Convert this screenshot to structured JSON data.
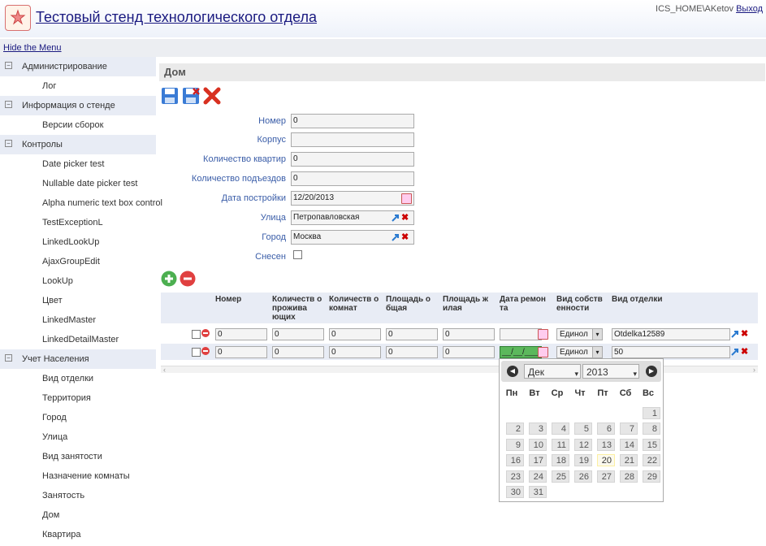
{
  "header": {
    "title": "Тестовый стенд технологического отдела",
    "user": "ICS_HOME\\AKetov",
    "logout": "Выход"
  },
  "menu": {
    "hide_label": "Hide the Menu"
  },
  "sidebar": {
    "sections": [
      {
        "label": "Администрирование",
        "items": [
          "Лог"
        ]
      },
      {
        "label": "Информация о стенде",
        "items": [
          "Версии сборок"
        ]
      },
      {
        "label": "Контролы",
        "items": [
          "Date picker test",
          "Nullable date picker test",
          "Alpha numeric text box control",
          "TestExceptionL",
          "LinkedLookUp",
          "AjaxGroupEdit",
          "LookUp",
          "Цвет",
          "LinkedMaster",
          "LinkedDetailMaster"
        ]
      },
      {
        "label": "Учет Населения",
        "items": [
          "Вид отделки",
          "Территория",
          "Город",
          "Улица",
          "Вид занятости",
          "Назначение комнаты",
          "Занятость",
          "Дом",
          "Квартира"
        ]
      }
    ]
  },
  "page": {
    "title": "Дом"
  },
  "form": {
    "nomer": {
      "label": "Номер",
      "value": "0"
    },
    "korpus": {
      "label": "Корпус",
      "value": ""
    },
    "kvartir": {
      "label": "Количество квартир",
      "value": "0"
    },
    "podezdov": {
      "label": "Количество подъездов",
      "value": "0"
    },
    "data": {
      "label": "Дата постройки",
      "value": "12/20/2013"
    },
    "ulica": {
      "label": "Улица",
      "value": "Петропавловская"
    },
    "gorod": {
      "label": "Город",
      "value": "Москва"
    },
    "snesen": {
      "label": "Снесен",
      "checked": false
    }
  },
  "grid": {
    "headers": [
      "Номер",
      "Количеств о прожива ющих",
      "Количеств о комнат",
      "Площадь о бщая",
      "Площадь ж илая",
      "Дата ремон та",
      "Вид собств енности",
      "Вид отделки"
    ],
    "rows": [
      {
        "nomer": "0",
        "projiv": "0",
        "komnat": "0",
        "obsh": "0",
        "jil": "0",
        "date": "",
        "sobst": "Единол",
        "otdelka": "Otdelka12589"
      },
      {
        "nomer": "0",
        "projiv": "0",
        "komnat": "0",
        "obsh": "0",
        "jil": "0",
        "date": "__/__/____",
        "sobst": "Единол",
        "otdelka": "50"
      }
    ]
  },
  "calendar": {
    "month": "Дек",
    "year": "2013",
    "weekdays": [
      "Пн",
      "Вт",
      "Ср",
      "Чт",
      "Пт",
      "Сб",
      "Вс"
    ],
    "weeks": [
      [
        "",
        "",
        "",
        "",
        "",
        "",
        "1"
      ],
      [
        "2",
        "3",
        "4",
        "5",
        "6",
        "7",
        "8"
      ],
      [
        "9",
        "10",
        "11",
        "12",
        "13",
        "14",
        "15"
      ],
      [
        "16",
        "17",
        "18",
        "19",
        "20",
        "21",
        "22"
      ],
      [
        "23",
        "24",
        "25",
        "26",
        "27",
        "28",
        "29"
      ],
      [
        "30",
        "31",
        "",
        "",
        "",
        "",
        ""
      ]
    ],
    "highlighted_day": "20"
  },
  "colors": {
    "accent": "#1a1a80",
    "label": "#3a5da8",
    "section_bg": "#e8ecf5"
  }
}
